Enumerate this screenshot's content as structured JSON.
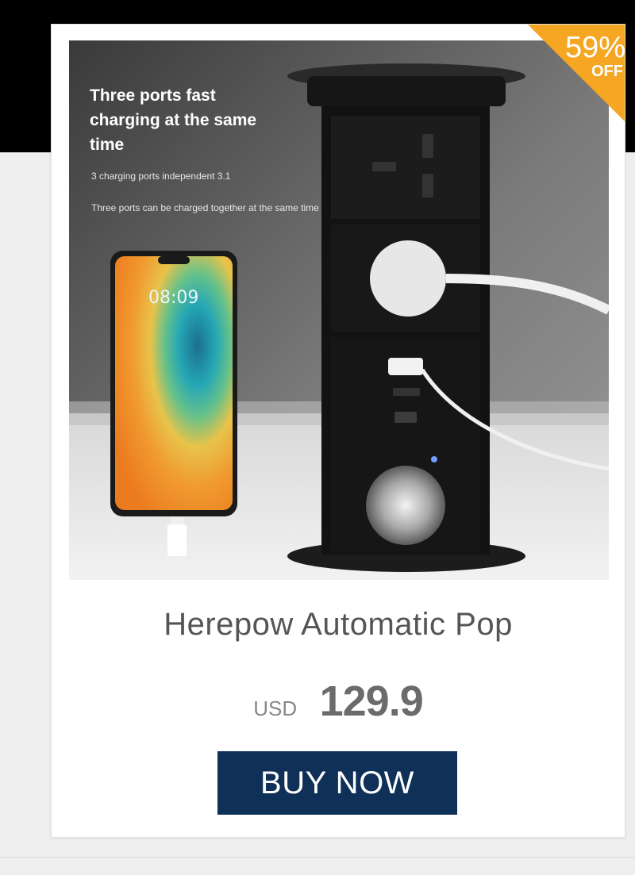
{
  "promo": {
    "discount_percent": "59%",
    "discount_label": "OFF",
    "image": {
      "headline": "Three ports fast charging at the same time",
      "subtext_1": "3 charging ports independent 3.1",
      "subtext_2": "Three ports can be charged together at the same time",
      "phone_clock": "08:09"
    },
    "product_title": "Herepow Automatic Pop",
    "currency": "USD",
    "price": "129.9",
    "buy_label": "BUY NOW"
  },
  "colors": {
    "badge": "#f5a623",
    "button": "#0f3057",
    "top_band": "#000000"
  }
}
